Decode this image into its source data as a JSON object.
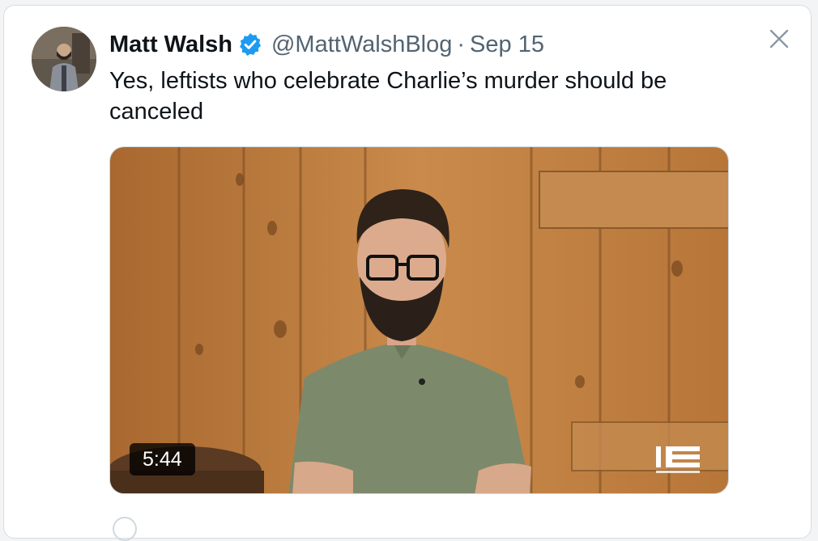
{
  "tweet": {
    "author_name": "Matt Walsh",
    "author_handle": "@MattWalshBlog",
    "separator": "·",
    "date": "Sep 15",
    "text": "Yes, leftists who celebrate Charlie’s murder should be canceled",
    "verified": true
  },
  "video": {
    "duration": "5:44",
    "watermark_icon": "daily-wire-10-logo"
  },
  "icons": {
    "close": "close-icon",
    "verified": "verified-badge-icon"
  },
  "colors": {
    "verified_blue": "#1d9bf0",
    "secondary_text": "#536471",
    "primary_text": "#0f1419"
  }
}
